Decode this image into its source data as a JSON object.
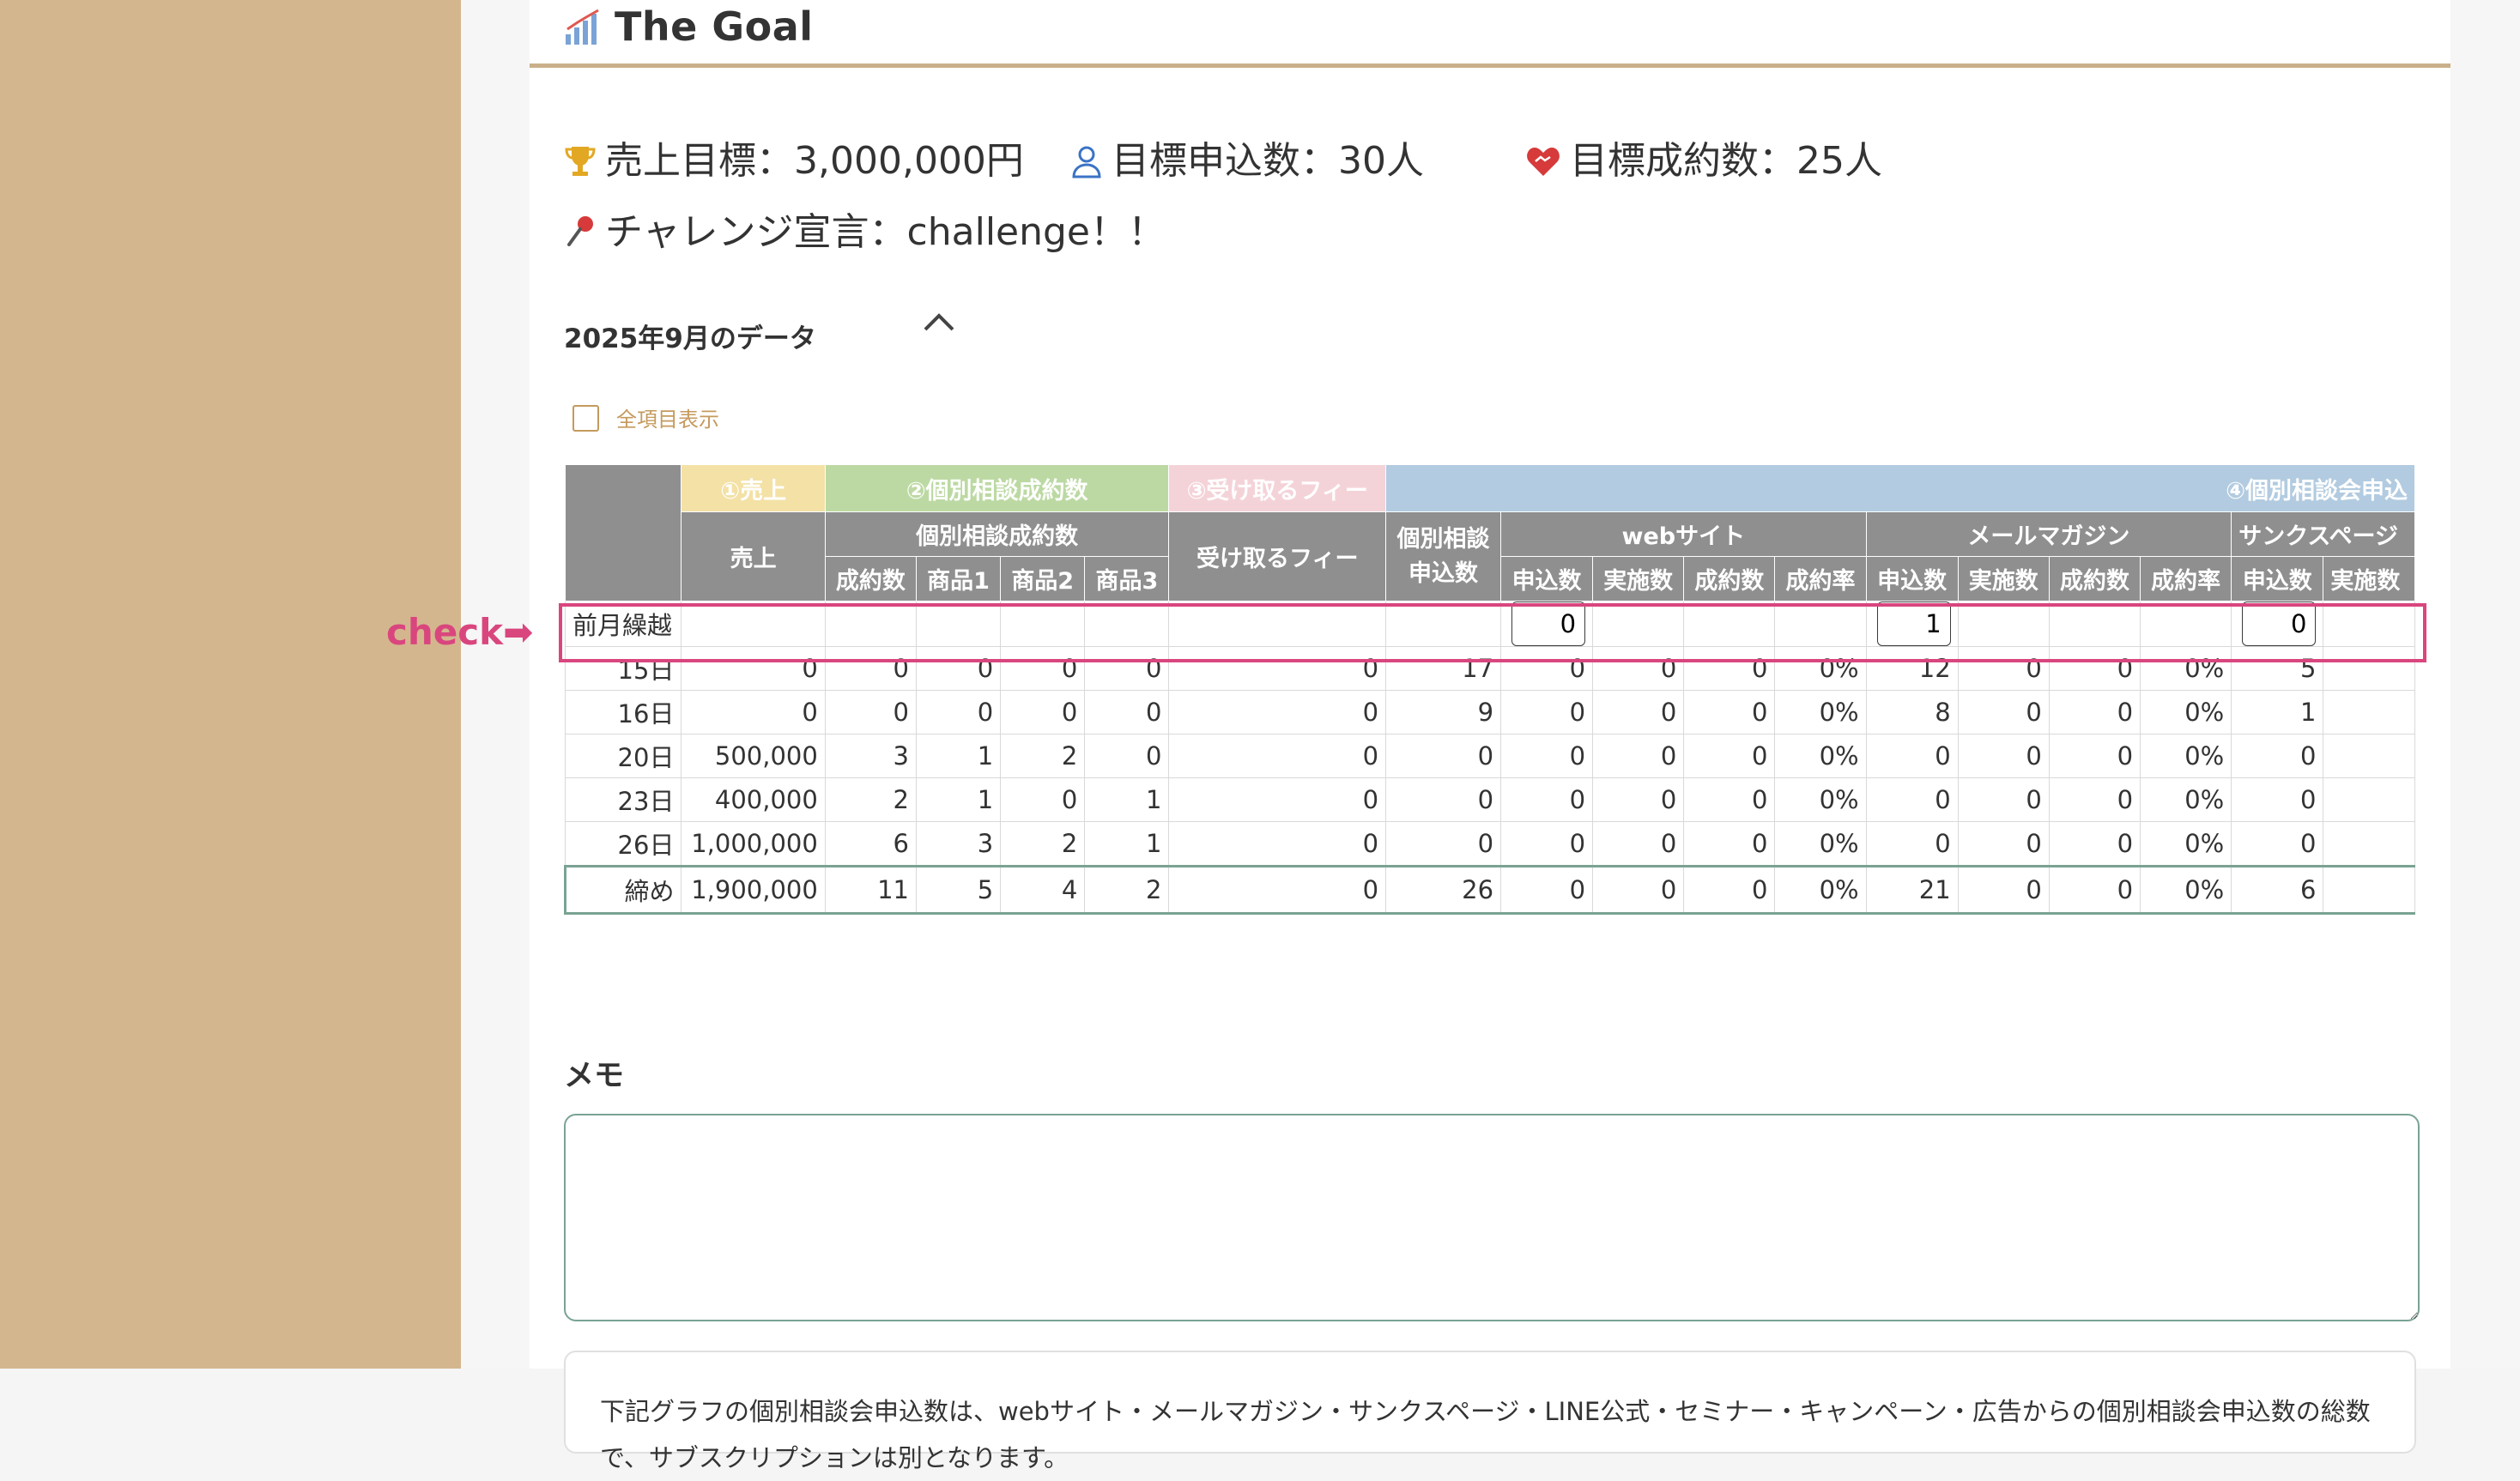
{
  "header": {
    "title": "The Goal"
  },
  "goals": {
    "sales": "売上目標：3,000,000円",
    "applications": "目標申込数：30人",
    "contracts": "目標成約数：25人",
    "challenge": "チャレンジ宣言：challenge！！"
  },
  "month": {
    "title": "2025年9月のデータ"
  },
  "show_all": {
    "label": "全項目表示"
  },
  "table": {
    "categories": [
      "①売上",
      "②個別相談成約数",
      "③受け取るフィー",
      "④個別相談会申込"
    ],
    "groups": {
      "sales": "売上",
      "contracts": "個別相談成約数",
      "fee": "受け取るフィー",
      "consult_line1": "個別相談",
      "consult_line2": "申込数",
      "website": "webサイト",
      "mailmag": "メールマガジン",
      "thanks": "サンクスページ"
    },
    "sub": [
      "成約数",
      "商品1",
      "商品2",
      "商品3",
      "申込数",
      "実施数",
      "成約数",
      "成約率",
      "申込数",
      "実施数",
      "成約数",
      "成約率",
      "申込数",
      "実施数"
    ],
    "carry": {
      "label": "前月繰越",
      "website_apply": "0",
      "mailmag_apply": "1",
      "thanks_apply": "0"
    },
    "rows": [
      [
        "15日",
        "0",
        "0",
        "0",
        "0",
        "0",
        "0",
        "17",
        "0",
        "0",
        "0",
        "0%",
        "12",
        "0",
        "0",
        "0%",
        "5",
        ""
      ],
      [
        "16日",
        "0",
        "0",
        "0",
        "0",
        "0",
        "0",
        "9",
        "0",
        "0",
        "0",
        "0%",
        "8",
        "0",
        "0",
        "0%",
        "1",
        ""
      ],
      [
        "20日",
        "500,000",
        "3",
        "1",
        "2",
        "0",
        "0",
        "0",
        "0",
        "0",
        "0",
        "0%",
        "0",
        "0",
        "0",
        "0%",
        "0",
        ""
      ],
      [
        "23日",
        "400,000",
        "2",
        "1",
        "0",
        "1",
        "0",
        "0",
        "0",
        "0",
        "0",
        "0%",
        "0",
        "0",
        "0",
        "0%",
        "0",
        ""
      ],
      [
        "26日",
        "1,000,000",
        "6",
        "3",
        "2",
        "1",
        "0",
        "0",
        "0",
        "0",
        "0",
        "0%",
        "0",
        "0",
        "0",
        "0%",
        "0",
        ""
      ]
    ],
    "total": [
      "締め",
      "1,900,000",
      "11",
      "5",
      "4",
      "2",
      "0",
      "26",
      "0",
      "0",
      "0",
      "0%",
      "21",
      "0",
      "0",
      "0%",
      "6",
      ""
    ]
  },
  "check": {
    "label": "check➡"
  },
  "memo": {
    "title": "メモ"
  },
  "note": {
    "text": "下記グラフの個別相談会申込数は、webサイト・メールマガジン・サンクスページ・LINE公式・セミナー・キャンペーン・広告からの個別相談会申込数の総数で、サブスクリプションは別となります。"
  }
}
